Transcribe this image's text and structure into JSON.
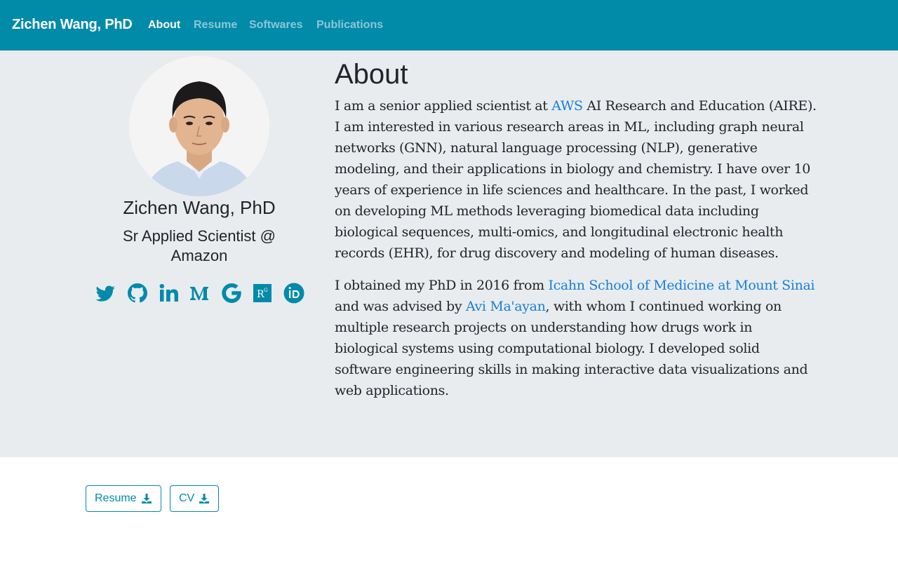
{
  "nav": {
    "brand": "Zichen Wang, PhD",
    "links": [
      {
        "label": "About"
      },
      {
        "label": "Resume"
      },
      {
        "label": "Softwares"
      },
      {
        "label": "Publications"
      }
    ]
  },
  "profile": {
    "name": "Zichen Wang, PhD",
    "subtitle": "Sr Applied Scientist @ Amazon",
    "social_icons": [
      "twitter-icon",
      "github-icon",
      "linkedin-icon",
      "medium-icon",
      "google-scholar-icon",
      "researchgate-icon",
      "orcid-icon"
    ]
  },
  "about": {
    "title": "About",
    "p1_before": "I am a senior applied scientist at ",
    "p1_link": "AWS",
    "p1_after": " AI Research and Education (AIRE). I am interested in various research areas in ML, including graph neural networks (GNN), natural language processing (NLP), generative modeling, and their applications in biology and chemistry. I have over 10 years of experience in life sciences and healthcare. In the past, I worked on developing ML methods leveraging biomedical data including biological sequences, multi-omics, and longitudinal electronic health records (EHR), for drug discovery and modeling of human diseases.",
    "p2_before": "I obtained my PhD in 2016 from ",
    "p2_link1": "Icahn School of Medicine at Mount Sinai",
    "p2_mid": " and was advised by ",
    "p2_link2": "Avi Ma'ayan",
    "p2_after": ", with whom I continued working on multiple research projects on understanding how drugs work in biological systems using computational biology. I developed solid software engineering skills in making interactive data visualizations and web applications."
  },
  "downloads": {
    "resume_label": "Resume",
    "cv_label": "CV"
  },
  "colors": {
    "navbar": "#028aa9",
    "hero_bg": "#e8ecef",
    "link": "#1a7fd6",
    "icon": "#028aa9"
  }
}
